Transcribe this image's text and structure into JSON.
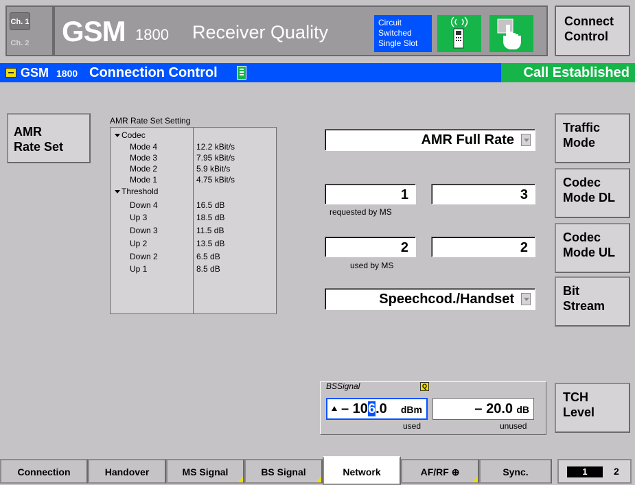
{
  "header": {
    "channels": [
      "Ch. 1",
      "Ch. 2"
    ],
    "title_gsm": "GSM",
    "title_band": "1800",
    "title_app": "Receiver Quality",
    "status_lines": [
      "Circuit",
      "Switched",
      "Single Slot"
    ],
    "connect_control": [
      "Connect",
      "Control"
    ]
  },
  "panel": {
    "title_gsm": "GSM",
    "title_band": "1800",
    "title": "Connection Control",
    "status": "Call Established"
  },
  "left": {
    "amr_button": [
      "AMR",
      "Rate Set"
    ],
    "amr_setting_label": "AMR Rate Set Setting",
    "codec_group": "Codec",
    "codec_rows": [
      {
        "name": "Mode 4",
        "value": "12.2 kBit/s"
      },
      {
        "name": "Mode 3",
        "value": "7.95 kBit/s"
      },
      {
        "name": "Mode 2",
        "value": "5.9 kBit/s"
      },
      {
        "name": "Mode 1",
        "value": "4.75 kBit/s"
      }
    ],
    "threshold_group": "Threshold",
    "threshold_rows": [
      {
        "name": "Down 4",
        "value": "16.5  dB"
      },
      {
        "name": "Up 3",
        "value": "18.5  dB"
      },
      {
        "name": "Down 3",
        "value": "11.5  dB"
      },
      {
        "name": "Up 2",
        "value": "13.5  dB"
      },
      {
        "name": "Down 2",
        "value": "6.5  dB"
      },
      {
        "name": "Up 1",
        "value": "8.5  dB"
      }
    ]
  },
  "center": {
    "traffic_mode_value": "AMR Full Rate",
    "codec_dl_requested": "1",
    "codec_dl_right": "3",
    "requested_label": "requested by MS",
    "codec_ul_used": "2",
    "codec_ul_right": "2",
    "used_label": "used by MS",
    "bit_stream_value": "Speechcod./Handset",
    "bs_signal_label": "BSSignal",
    "bs_signal_marker": "Q",
    "bs_used_prefix": "– 10",
    "bs_used_cursor": "6",
    "bs_used_suffix": ".0",
    "bs_used_unit": "dBm",
    "bs_used_caption": "used",
    "bs_unused_value": "– 20.0",
    "bs_unused_unit": "dB",
    "bs_unused_caption": "unused"
  },
  "right_buttons": [
    [
      "Traffic",
      "Mode"
    ],
    [
      "Codec",
      "Mode DL"
    ],
    [
      "Codec",
      "Mode UL"
    ],
    [
      "Bit",
      "Stream"
    ],
    [
      "TCH",
      "Level"
    ]
  ],
  "tabs": [
    "Connection",
    "Handover",
    "MS Signal",
    "BS Signal",
    "Network",
    "AF/RF",
    "Sync."
  ],
  "active_tab": "Network",
  "pages": [
    "1",
    "2"
  ],
  "colors": {
    "accent_blue": "#0052ff",
    "status_green": "#16b54a",
    "marker_yellow": "#f0e000"
  }
}
